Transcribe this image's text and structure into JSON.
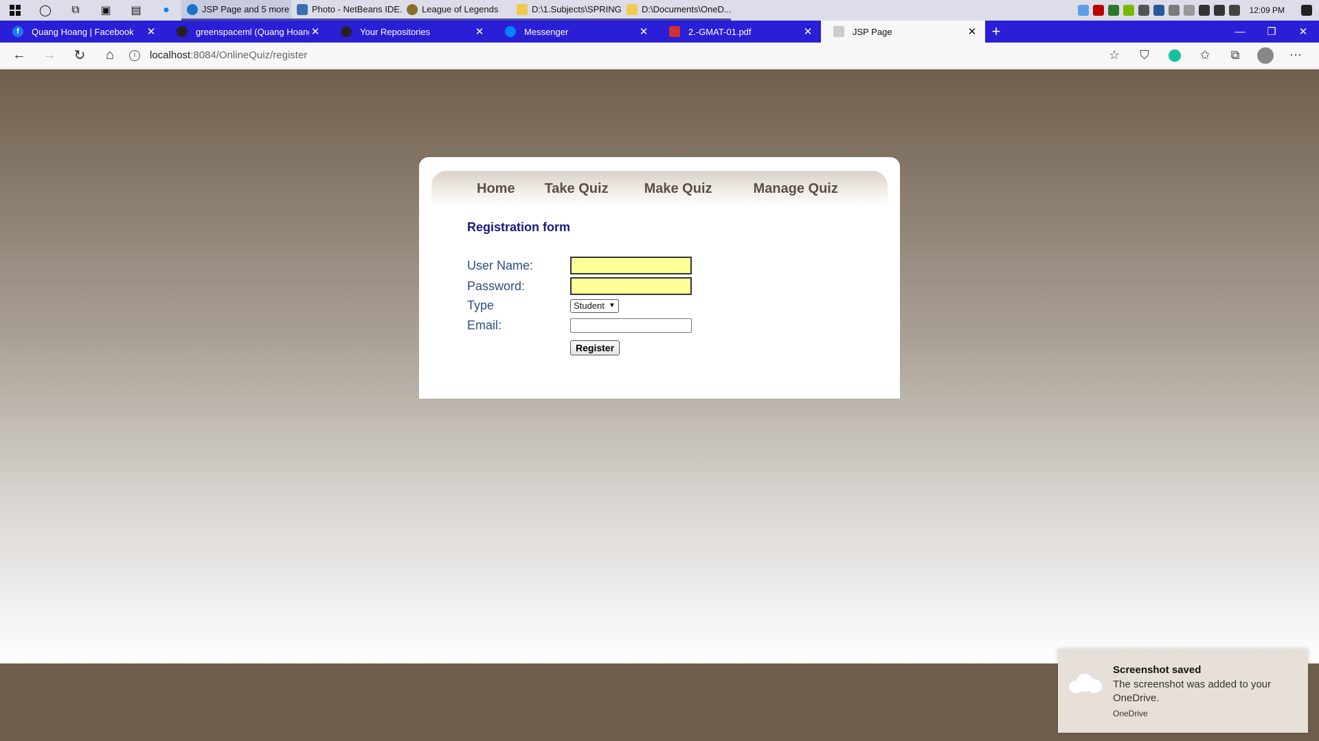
{
  "taskbar": {
    "apps": [
      {
        "label": "JSP Page and 5 more ...",
        "color": "#1a73c8"
      },
      {
        "label": "Photo - NetBeans IDE...",
        "color": "#3a6fb0"
      },
      {
        "label": "League of Legends",
        "color": "#8a6d2a"
      },
      {
        "label": "D:\\1.Subjects\\SPRING...",
        "color": "#f2c94c"
      },
      {
        "label": "D:\\Documents\\OneD...",
        "color": "#f2c94c"
      }
    ],
    "clock": "12:09 PM"
  },
  "tabs": [
    {
      "label": "Quang Hoang | Facebook",
      "favicon": "facebook-icon",
      "color": "#1877f2"
    },
    {
      "label": "greenspaceml (Quang Hoang)",
      "favicon": "github-icon",
      "color": "#222"
    },
    {
      "label": "Your Repositories",
      "favicon": "github-icon",
      "color": "#222"
    },
    {
      "label": "Messenger",
      "favicon": "messenger-icon",
      "color": "#0084ff"
    },
    {
      "label": "2.-GMAT-01.pdf",
      "favicon": "pdf-icon",
      "color": "#d32f2f"
    },
    {
      "label": "JSP Page",
      "favicon": "page-icon",
      "color": "#888"
    }
  ],
  "address": {
    "host": "localhost",
    "path": ":8084/OnlineQuiz/register"
  },
  "menu": {
    "items": [
      "Home",
      "Take Quiz",
      "Make Quiz",
      "Manage Quiz"
    ]
  },
  "form": {
    "title": "Registration form",
    "username_label": "User Name:",
    "password_label": "Password:",
    "type_label": "Type",
    "type_selected": "Student",
    "email_label": "Email:",
    "submit_label": "Register"
  },
  "toast": {
    "title": "Screenshot saved",
    "body": "The screenshot was added to your OneDrive.",
    "source": "OneDrive"
  }
}
